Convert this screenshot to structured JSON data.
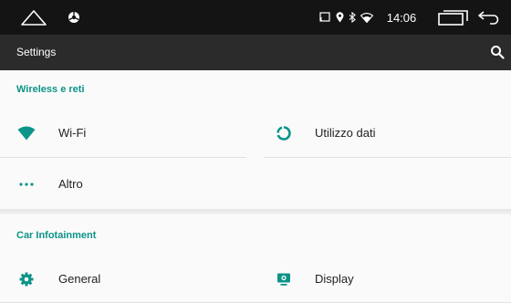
{
  "status_bar": {
    "time": "14:06",
    "icons": [
      "home-outline-icon",
      "car-wheel-icon",
      "screen-cast-icon",
      "location-icon",
      "bluetooth-icon",
      "wifi-icon",
      "recent-apps-icon",
      "back-arrow-icon"
    ]
  },
  "action_bar": {
    "title": "Settings",
    "search_icon": "search-icon"
  },
  "sections": [
    {
      "header": "Wireless e reti",
      "items": [
        {
          "label": "Wi-Fi",
          "icon": "wifi-icon"
        },
        {
          "label": "Utilizzo dati",
          "icon": "data-usage-icon"
        },
        {
          "label": "Altro",
          "icon": "more-dots-icon"
        }
      ]
    },
    {
      "header": "Car Infotainment",
      "items": [
        {
          "label": "General",
          "icon": "gear-icon"
        },
        {
          "label": "Display",
          "icon": "display-icon"
        }
      ]
    }
  ],
  "colors": {
    "accent": "#0d9488",
    "status_bar": "#141414",
    "action_bar": "#2b2b2b",
    "background": "#fafafa"
  }
}
